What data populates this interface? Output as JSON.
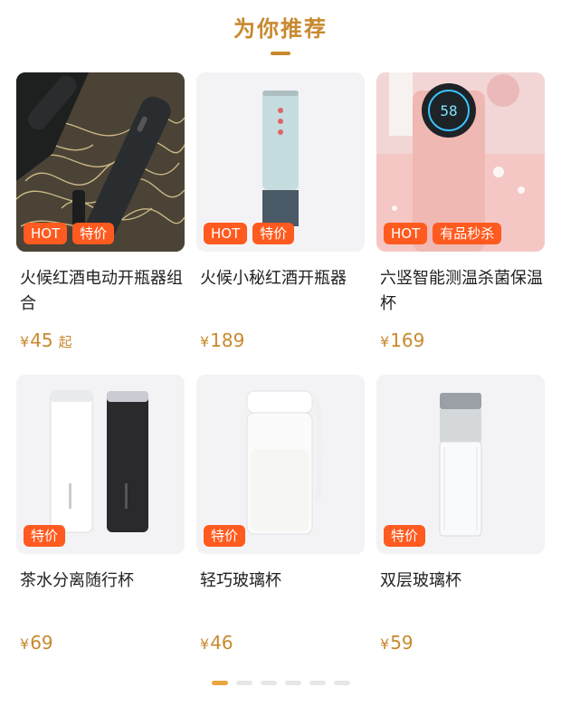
{
  "section": {
    "title": "为你推荐"
  },
  "products": [
    {
      "name": "火候红酒电动开瓶器组合",
      "price": "45",
      "price_suffix": "起",
      "badges": [
        "HOT",
        "特价"
      ],
      "image": "wine-opener-set"
    },
    {
      "name": "火候小秘红酒开瓶器",
      "price": "189",
      "price_suffix": "",
      "badges": [
        "HOT",
        "特价"
      ],
      "image": "electric-wine-opener"
    },
    {
      "name": "六竖智能测温杀菌保温杯",
      "price": "169",
      "price_suffix": "",
      "badges": [
        "HOT",
        "有品秒杀"
      ],
      "image": "smart-thermos"
    },
    {
      "name": "茶水分离随行杯",
      "price": "69",
      "price_suffix": "",
      "badges": [
        "特价"
      ],
      "image": "tea-separation-cups"
    },
    {
      "name": "轻巧玻璃杯",
      "price": "46",
      "price_suffix": "",
      "badges": [
        "特价"
      ],
      "image": "glass-bottle"
    },
    {
      "name": "双层玻璃杯",
      "price": "59",
      "price_suffix": "",
      "badges": [
        "特价"
      ],
      "image": "double-glass-cup"
    }
  ],
  "currency_symbol": "¥",
  "pager": {
    "count": 6,
    "active_index": 0
  },
  "colors": {
    "accent": "#c8892e",
    "badge": "#ff5a1f",
    "pager_active": "#e9a640",
    "pager_inactive": "#e7e7ea"
  }
}
